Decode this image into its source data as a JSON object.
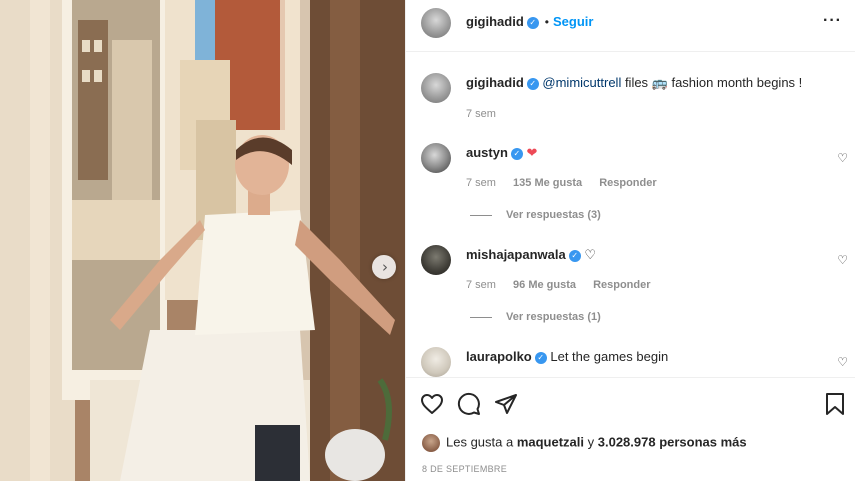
{
  "post": {
    "author": "gigihadid",
    "follow_label": "Seguir",
    "dot": "•",
    "more_label": "···",
    "caption_author": "gigihadid",
    "caption_mention": "@mimicuttrell",
    "caption_text": " files 🚌 fashion month begins !",
    "caption_time": "7 sem"
  },
  "comments": [
    {
      "user": "austyn",
      "text": "❤",
      "time": "7 sem",
      "likes": "135 Me gusta",
      "reply_label": "Responder",
      "view_replies": "Ver respuestas (3)"
    },
    {
      "user": "mishajapanwala",
      "text": "♡",
      "time": "7 sem",
      "likes": "96 Me gusta",
      "reply_label": "Responder",
      "view_replies": "Ver respuestas (1)"
    },
    {
      "user": "laurapolko",
      "text": "Let the games begin"
    }
  ],
  "likes_summary": {
    "prefix": "Les gusta a ",
    "liker": "maquetzali",
    "middle": " y ",
    "count": "3.028.978 personas más"
  },
  "post_date": "8 DE SEPTIEMBRE",
  "icons": {
    "verified": "✓",
    "heart_small": "♡",
    "next": "›"
  },
  "colors": {
    "accent": "#0095f6",
    "verified": "#3897f0",
    "muted": "#8e8e8e",
    "heart_red": "#ed4956"
  }
}
